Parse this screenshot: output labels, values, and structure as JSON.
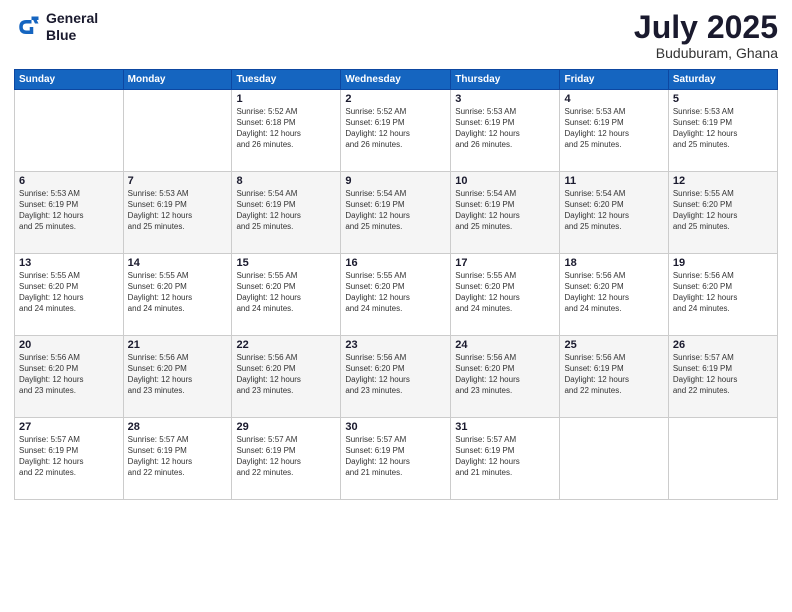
{
  "logo": {
    "line1": "General",
    "line2": "Blue"
  },
  "title": "July 2025",
  "subtitle": "Buduburam, Ghana",
  "days_of_week": [
    "Sunday",
    "Monday",
    "Tuesday",
    "Wednesday",
    "Thursday",
    "Friday",
    "Saturday"
  ],
  "weeks": [
    [
      {
        "day": "",
        "info": ""
      },
      {
        "day": "",
        "info": ""
      },
      {
        "day": "1",
        "info": "Sunrise: 5:52 AM\nSunset: 6:18 PM\nDaylight: 12 hours\nand 26 minutes."
      },
      {
        "day": "2",
        "info": "Sunrise: 5:52 AM\nSunset: 6:19 PM\nDaylight: 12 hours\nand 26 minutes."
      },
      {
        "day": "3",
        "info": "Sunrise: 5:53 AM\nSunset: 6:19 PM\nDaylight: 12 hours\nand 26 minutes."
      },
      {
        "day": "4",
        "info": "Sunrise: 5:53 AM\nSunset: 6:19 PM\nDaylight: 12 hours\nand 25 minutes."
      },
      {
        "day": "5",
        "info": "Sunrise: 5:53 AM\nSunset: 6:19 PM\nDaylight: 12 hours\nand 25 minutes."
      }
    ],
    [
      {
        "day": "6",
        "info": "Sunrise: 5:53 AM\nSunset: 6:19 PM\nDaylight: 12 hours\nand 25 minutes."
      },
      {
        "day": "7",
        "info": "Sunrise: 5:53 AM\nSunset: 6:19 PM\nDaylight: 12 hours\nand 25 minutes."
      },
      {
        "day": "8",
        "info": "Sunrise: 5:54 AM\nSunset: 6:19 PM\nDaylight: 12 hours\nand 25 minutes."
      },
      {
        "day": "9",
        "info": "Sunrise: 5:54 AM\nSunset: 6:19 PM\nDaylight: 12 hours\nand 25 minutes."
      },
      {
        "day": "10",
        "info": "Sunrise: 5:54 AM\nSunset: 6:19 PM\nDaylight: 12 hours\nand 25 minutes."
      },
      {
        "day": "11",
        "info": "Sunrise: 5:54 AM\nSunset: 6:20 PM\nDaylight: 12 hours\nand 25 minutes."
      },
      {
        "day": "12",
        "info": "Sunrise: 5:55 AM\nSunset: 6:20 PM\nDaylight: 12 hours\nand 25 minutes."
      }
    ],
    [
      {
        "day": "13",
        "info": "Sunrise: 5:55 AM\nSunset: 6:20 PM\nDaylight: 12 hours\nand 24 minutes."
      },
      {
        "day": "14",
        "info": "Sunrise: 5:55 AM\nSunset: 6:20 PM\nDaylight: 12 hours\nand 24 minutes."
      },
      {
        "day": "15",
        "info": "Sunrise: 5:55 AM\nSunset: 6:20 PM\nDaylight: 12 hours\nand 24 minutes."
      },
      {
        "day": "16",
        "info": "Sunrise: 5:55 AM\nSunset: 6:20 PM\nDaylight: 12 hours\nand 24 minutes."
      },
      {
        "day": "17",
        "info": "Sunrise: 5:55 AM\nSunset: 6:20 PM\nDaylight: 12 hours\nand 24 minutes."
      },
      {
        "day": "18",
        "info": "Sunrise: 5:56 AM\nSunset: 6:20 PM\nDaylight: 12 hours\nand 24 minutes."
      },
      {
        "day": "19",
        "info": "Sunrise: 5:56 AM\nSunset: 6:20 PM\nDaylight: 12 hours\nand 24 minutes."
      }
    ],
    [
      {
        "day": "20",
        "info": "Sunrise: 5:56 AM\nSunset: 6:20 PM\nDaylight: 12 hours\nand 23 minutes."
      },
      {
        "day": "21",
        "info": "Sunrise: 5:56 AM\nSunset: 6:20 PM\nDaylight: 12 hours\nand 23 minutes."
      },
      {
        "day": "22",
        "info": "Sunrise: 5:56 AM\nSunset: 6:20 PM\nDaylight: 12 hours\nand 23 minutes."
      },
      {
        "day": "23",
        "info": "Sunrise: 5:56 AM\nSunset: 6:20 PM\nDaylight: 12 hours\nand 23 minutes."
      },
      {
        "day": "24",
        "info": "Sunrise: 5:56 AM\nSunset: 6:20 PM\nDaylight: 12 hours\nand 23 minutes."
      },
      {
        "day": "25",
        "info": "Sunrise: 5:56 AM\nSunset: 6:19 PM\nDaylight: 12 hours\nand 22 minutes."
      },
      {
        "day": "26",
        "info": "Sunrise: 5:57 AM\nSunset: 6:19 PM\nDaylight: 12 hours\nand 22 minutes."
      }
    ],
    [
      {
        "day": "27",
        "info": "Sunrise: 5:57 AM\nSunset: 6:19 PM\nDaylight: 12 hours\nand 22 minutes."
      },
      {
        "day": "28",
        "info": "Sunrise: 5:57 AM\nSunset: 6:19 PM\nDaylight: 12 hours\nand 22 minutes."
      },
      {
        "day": "29",
        "info": "Sunrise: 5:57 AM\nSunset: 6:19 PM\nDaylight: 12 hours\nand 22 minutes."
      },
      {
        "day": "30",
        "info": "Sunrise: 5:57 AM\nSunset: 6:19 PM\nDaylight: 12 hours\nand 21 minutes."
      },
      {
        "day": "31",
        "info": "Sunrise: 5:57 AM\nSunset: 6:19 PM\nDaylight: 12 hours\nand 21 minutes."
      },
      {
        "day": "",
        "info": ""
      },
      {
        "day": "",
        "info": ""
      }
    ]
  ]
}
